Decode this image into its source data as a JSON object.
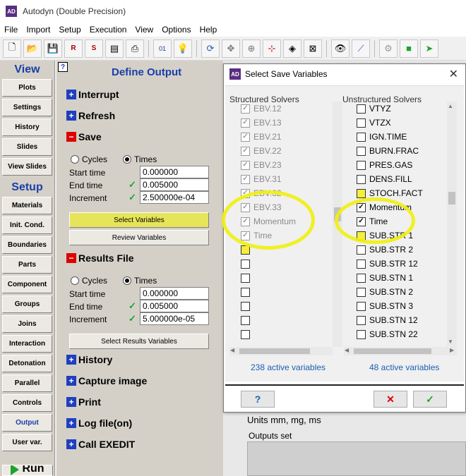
{
  "app": {
    "title": "Autodyn (Double Precision)",
    "icon_text": "AD"
  },
  "menu": [
    "File",
    "Import",
    "Setup",
    "Execution",
    "View",
    "Options",
    "Help"
  ],
  "toolbar_icons": [
    "new-file-icon",
    "open-folder-icon",
    "save-icon",
    "save-as-icon",
    "save-restart-icon",
    "save-model-icon",
    "print-icon",
    "binary-icon",
    "lightbulb-icon",
    "refresh-icon",
    "move-icon",
    "zoom-icon",
    "axes-icon",
    "fit-view-icon",
    "window-icon",
    "eye-icon",
    "chart-icon",
    "gear-icon",
    "cube-icon",
    "arrow-icon"
  ],
  "left_nav": {
    "view_header": "View",
    "view_items": [
      "Plots",
      "Settings",
      "History",
      "Slides",
      "View Slides"
    ],
    "setup_header": "Setup",
    "setup_items": [
      "Materials",
      "Init. Cond.",
      "Boundaries",
      "Parts",
      "Component",
      "Groups",
      "Joins",
      "Interaction",
      "Detonation",
      "Parallel",
      "Controls",
      "Output",
      "User var."
    ],
    "active_item": "Output",
    "run_label": "Run"
  },
  "define_output": {
    "help_label": "?",
    "title": "Define Output",
    "interrupt": "Interrupt",
    "refresh": "Refresh",
    "save": {
      "label": "Save",
      "cycles_label": "Cycles",
      "times_label": "Times",
      "start_time_label": "Start time",
      "start_time_value": "0.000000",
      "end_time_label": "End time",
      "end_time_value": "0.005000",
      "increment_label": "Increment",
      "increment_value": "2.500000e-04",
      "select_button": "Select Variables",
      "review_button": "Review Variables"
    },
    "results": {
      "label": "Results File",
      "cycles_label": "Cycles",
      "times_label": "Times",
      "start_time_label": "Start time",
      "start_time_value": "0.000000",
      "end_time_label": "End time",
      "end_time_value": "0.005000",
      "increment_label": "Increment",
      "increment_value": "5.000000e-05",
      "select_button": "Select Results Variables"
    },
    "more_sections": [
      "History",
      "Capture image",
      "Print",
      "Log file(on)",
      "Call EXEDIT"
    ]
  },
  "right_panel": {
    "units_text": "Units mm, mg, ms",
    "outputs_label": "Outputs set"
  },
  "dialog": {
    "title": "Select Save Variables",
    "structured_header": "Structured Solvers",
    "unstructured_header": "Unstructured Solvers",
    "structured_items": [
      {
        "label": "EBV.12",
        "checked": true,
        "disabled": true
      },
      {
        "label": "EBV.13",
        "checked": true,
        "disabled": true
      },
      {
        "label": "EBV.21",
        "checked": true,
        "disabled": true
      },
      {
        "label": "EBV.22",
        "checked": true,
        "disabled": true
      },
      {
        "label": "EBV.23",
        "checked": true,
        "disabled": true
      },
      {
        "label": "EBV.31",
        "checked": true,
        "disabled": true
      },
      {
        "label": "EBV.32",
        "checked": true,
        "disabled": true
      },
      {
        "label": "EBV.33",
        "checked": true,
        "disabled": true
      },
      {
        "label": "Momentum",
        "checked": true,
        "disabled": true
      },
      {
        "label": "Time",
        "checked": true,
        "disabled": true
      },
      {
        "label": "",
        "checked": false,
        "yellow": true
      },
      {
        "label": "",
        "checked": false
      },
      {
        "label": "",
        "checked": false
      },
      {
        "label": "",
        "checked": false
      },
      {
        "label": "",
        "checked": false
      },
      {
        "label": "",
        "checked": false
      },
      {
        "label": "",
        "checked": false
      }
    ],
    "unstructured_items": [
      {
        "label": "VTYZ",
        "checked": false
      },
      {
        "label": "VTZX",
        "checked": false
      },
      {
        "label": "IGN.TIME",
        "checked": false
      },
      {
        "label": "BURN.FRAC",
        "checked": false
      },
      {
        "label": "PRES.GAS",
        "checked": false
      },
      {
        "label": "DENS.FILL",
        "checked": false
      },
      {
        "label": "STOCH.FACT",
        "checked": false,
        "yellow": true
      },
      {
        "label": "Momentum",
        "checked": true
      },
      {
        "label": "Time",
        "checked": true
      },
      {
        "label": "SUB.STR 1",
        "checked": false,
        "yellow": true
      },
      {
        "label": "SUB.STR 2",
        "checked": false
      },
      {
        "label": "SUB.STR 12",
        "checked": false
      },
      {
        "label": "SUB.STN 1",
        "checked": false
      },
      {
        "label": "SUB.STN 2",
        "checked": false
      },
      {
        "label": "SUB.STN 3",
        "checked": false
      },
      {
        "label": "SUB.STN 12",
        "checked": false
      },
      {
        "label": "SUB.STN 22",
        "checked": false
      }
    ],
    "structured_count": "238 active variables",
    "unstructured_count": "48 active variables",
    "help_button": "?",
    "cancel_button": "✕",
    "ok_button": "✓"
  }
}
